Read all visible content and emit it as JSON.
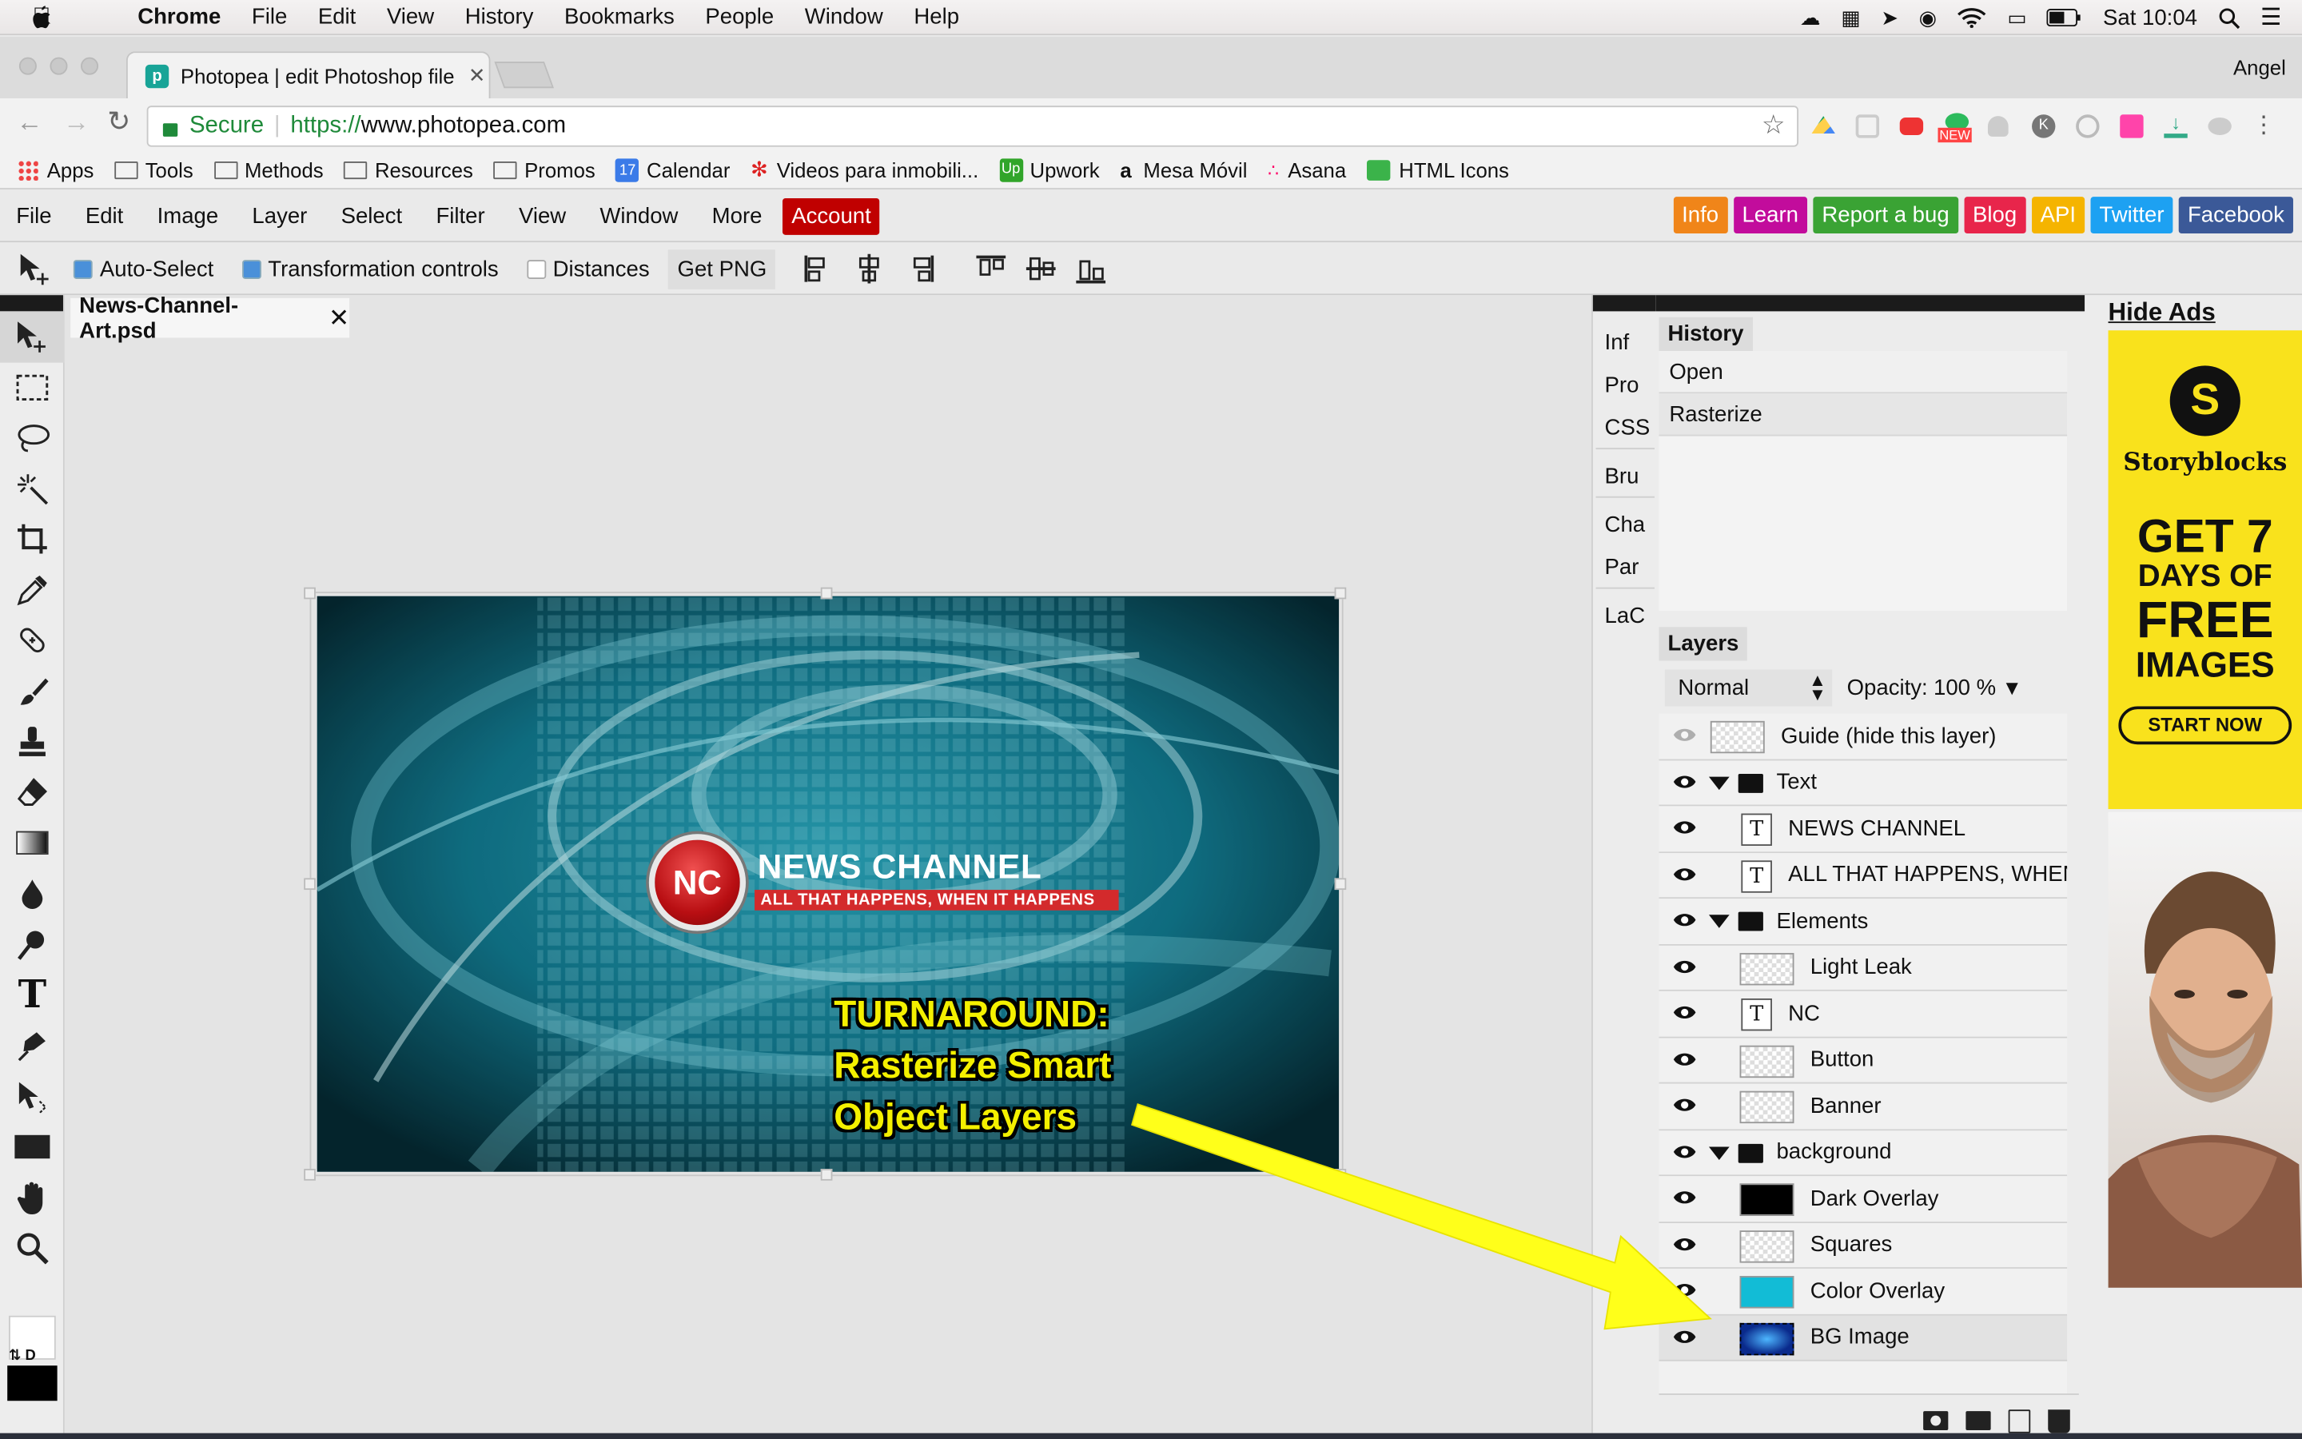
{
  "mac_menu": {
    "app": "Chrome",
    "items": [
      "File",
      "Edit",
      "View",
      "History",
      "Bookmarks",
      "People",
      "Window",
      "Help"
    ],
    "clock": "Sat 10:04"
  },
  "browser": {
    "tab_title": "Photopea | edit Photoshop file",
    "profile": "Angel",
    "secure_label": "Secure",
    "url_scheme": "https://",
    "url_host": "www.photopea.com",
    "bookmarks": [
      "Apps",
      "Tools",
      "Methods",
      "Resources",
      "Promos",
      "Calendar",
      "Videos para inmobili...",
      "Upwork",
      "Mesa Móvil",
      "Asana",
      "HTML Icons"
    ],
    "calendar_day": "17",
    "ext_badge": "NEW"
  },
  "app_menu": {
    "items": [
      "File",
      "Edit",
      "Image",
      "Layer",
      "Select",
      "Filter",
      "View",
      "Window",
      "More"
    ],
    "account": "Account",
    "links": [
      {
        "label": "Info",
        "color": "#f08519"
      },
      {
        "label": "Learn",
        "color": "#c20c9c"
      },
      {
        "label": "Report a bug",
        "color": "#3aa334"
      },
      {
        "label": "Blog",
        "color": "#e8254b"
      },
      {
        "label": "API",
        "color": "#f5b400"
      },
      {
        "label": "Twitter",
        "color": "#1da1f2"
      },
      {
        "label": "Facebook",
        "color": "#3b5998"
      }
    ]
  },
  "options": {
    "auto_select": "Auto-Select",
    "transform_controls": "Transformation controls",
    "distances": "Distances",
    "get_png": "Get PNG"
  },
  "document": {
    "tab": "News-Channel-Art.psd",
    "logo_text": "NC",
    "title": "NEWS CHANNEL",
    "tagline": "ALL THAT HAPPENS, WHEN IT HAPPENS",
    "annotation": [
      "TURNAROUND:",
      "Rasterize Smart",
      "Object Layers"
    ]
  },
  "mini_panels": [
    "Inf",
    "Pro",
    "CSS",
    "Bru",
    "Cha",
    "Par",
    "LaC"
  ],
  "history": {
    "title": "History",
    "items": [
      "Open",
      "Rasterize"
    ]
  },
  "layers": {
    "title": "Layers",
    "blend_mode": "Normal",
    "opacity_label": "Opacity:",
    "opacity_value": "100 %",
    "rows": [
      {
        "name": "Guide (hide this layer)"
      },
      {
        "name": "Text"
      },
      {
        "name": "NEWS CHANNEL"
      },
      {
        "name": "ALL THAT HAPPENS, WHEN IT"
      },
      {
        "name": "Elements"
      },
      {
        "name": "Light Leak"
      },
      {
        "name": "NC"
      },
      {
        "name": "Button"
      },
      {
        "name": "Banner"
      },
      {
        "name": "background"
      },
      {
        "name": "Dark Overlay"
      },
      {
        "name": "Squares"
      },
      {
        "name": "Color Overlay"
      },
      {
        "name": "BG Image"
      }
    ]
  },
  "ad": {
    "hide_ads": "Hide Ads",
    "brand": "Storyblocks",
    "line1": "GET 7",
    "line2": "DAYS OF",
    "line3": "FREE",
    "line4": "IMAGES",
    "cta": "START NOW"
  },
  "colors": {
    "accent": "#c00000",
    "yellow_arrow": "#ffff00",
    "ad_bg": "#f9e21c"
  }
}
